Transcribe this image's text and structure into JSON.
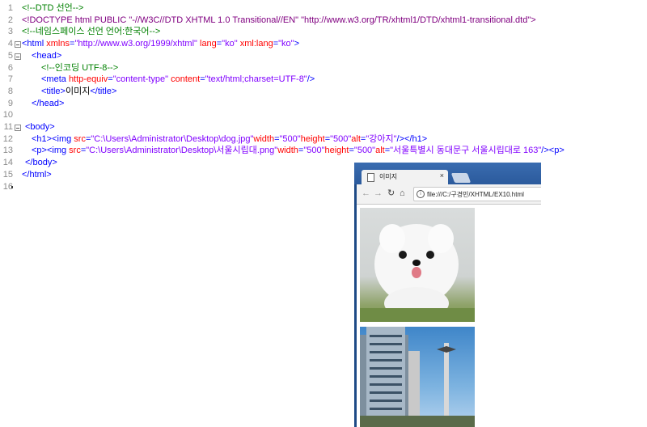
{
  "editor": {
    "lines": [
      {
        "n": "1",
        "fold": false,
        "indent": 27,
        "segs": [
          {
            "t": "<!--DTD 선언-->",
            "c": "com"
          }
        ]
      },
      {
        "n": "2",
        "fold": false,
        "indent": 27,
        "segs": [
          {
            "t": "<!DOCTYPE html PUBLIC \"-//W3C//DTD XHTML 1.0 Transitional//EN\" \"http://www.w3.org/TR/xhtml1/DTD/xhtml1-transitional.dtd\">",
            "c": "doc"
          }
        ]
      },
      {
        "n": "3",
        "fold": false,
        "indent": 27,
        "segs": [
          {
            "t": "<!--네임스페이스 선언 언어:한국어-->",
            "c": "com"
          }
        ]
      },
      {
        "n": "4",
        "fold": true,
        "indent": 27,
        "segs": [
          {
            "t": "<html ",
            "c": "tag"
          },
          {
            "t": "xmlns",
            "c": "attr"
          },
          {
            "t": "=",
            "c": "tag"
          },
          {
            "t": "\"http://www.w3.org/1999/xhtml\"",
            "c": "val"
          },
          {
            "t": " lang",
            "c": "attr"
          },
          {
            "t": "=",
            "c": "tag"
          },
          {
            "t": "\"ko\"",
            "c": "val"
          },
          {
            "t": " xml:lang",
            "c": "attr"
          },
          {
            "t": "=",
            "c": "tag"
          },
          {
            "t": "\"ko\"",
            "c": "val"
          },
          {
            "t": ">",
            "c": "tag"
          }
        ]
      },
      {
        "n": "5",
        "fold": true,
        "indent": 39,
        "segs": [
          {
            "t": "<head>",
            "c": "tag"
          }
        ]
      },
      {
        "n": "6",
        "fold": false,
        "indent": 51,
        "segs": [
          {
            "t": "<!--인코딩 UTF-8-->",
            "c": "com"
          }
        ]
      },
      {
        "n": "7",
        "fold": false,
        "indent": 51,
        "segs": [
          {
            "t": "<meta ",
            "c": "tag"
          },
          {
            "t": "http-equiv",
            "c": "attr"
          },
          {
            "t": "=",
            "c": "tag"
          },
          {
            "t": "\"content-type\"",
            "c": "val"
          },
          {
            "t": " content",
            "c": "attr"
          },
          {
            "t": "=",
            "c": "tag"
          },
          {
            "t": "\"text/html;charset=UTF-8\"",
            "c": "val"
          },
          {
            "t": "/>",
            "c": "tag"
          }
        ]
      },
      {
        "n": "8",
        "fold": false,
        "indent": 51,
        "segs": [
          {
            "t": "<title>",
            "c": "tag"
          },
          {
            "t": "이미지",
            "c": "txt"
          },
          {
            "t": "</title>",
            "c": "tag"
          }
        ]
      },
      {
        "n": "9",
        "fold": false,
        "indent": 39,
        "segs": [
          {
            "t": "</head>",
            "c": "tag"
          }
        ]
      },
      {
        "n": "10",
        "fold": false,
        "indent": 27,
        "segs": []
      },
      {
        "n": "11",
        "fold": true,
        "indent": 31,
        "segs": [
          {
            "t": "<body>",
            "c": "tag"
          }
        ]
      },
      {
        "n": "12",
        "fold": false,
        "indent": 39,
        "segs": [
          {
            "t": "<h1><img ",
            "c": "tag"
          },
          {
            "t": "src",
            "c": "attr"
          },
          {
            "t": "=",
            "c": "tag"
          },
          {
            "t": "\"C:\\Users\\Administrator\\Desktop\\dog.jpg\"",
            "c": "val"
          },
          {
            "t": "width",
            "c": "attr"
          },
          {
            "t": "=",
            "c": "tag"
          },
          {
            "t": "\"500\"",
            "c": "val"
          },
          {
            "t": "height",
            "c": "attr"
          },
          {
            "t": "=",
            "c": "tag"
          },
          {
            "t": "\"500\"",
            "c": "val"
          },
          {
            "t": "alt",
            "c": "attr"
          },
          {
            "t": "=",
            "c": "tag"
          },
          {
            "t": "\"강아지\"",
            "c": "val"
          },
          {
            "t": "/></h1>",
            "c": "tag"
          }
        ]
      },
      {
        "n": "13",
        "fold": false,
        "indent": 39,
        "segs": [
          {
            "t": "<p><img ",
            "c": "tag"
          },
          {
            "t": "src",
            "c": "attr"
          },
          {
            "t": "=",
            "c": "tag"
          },
          {
            "t": "\"C:\\Users\\Administrator\\Desktop\\서울시립대.png\"",
            "c": "val"
          },
          {
            "t": "width",
            "c": "attr"
          },
          {
            "t": "=",
            "c": "tag"
          },
          {
            "t": "\"500\"",
            "c": "val"
          },
          {
            "t": "height",
            "c": "attr"
          },
          {
            "t": "=",
            "c": "tag"
          },
          {
            "t": "\"500\"",
            "c": "val"
          },
          {
            "t": "alt",
            "c": "attr"
          },
          {
            "t": "=",
            "c": "tag"
          },
          {
            "t": "\"서울특별시 동대문구 서울시립대로 163\"",
            "c": "val"
          },
          {
            "t": "/><p>",
            "c": "tag"
          }
        ]
      },
      {
        "n": "14",
        "fold": false,
        "indent": 31,
        "segs": [
          {
            "t": "</body>",
            "c": "tag"
          }
        ]
      },
      {
        "n": "15",
        "fold": false,
        "indent": 27,
        "segs": [
          {
            "t": "</html>",
            "c": "tag"
          }
        ]
      },
      {
        "n": "16",
        "fold": false,
        "indent": 27,
        "segs": []
      }
    ]
  },
  "browser": {
    "tab_title": "이미지",
    "tab_close": "×",
    "url": "file:///C:/구경민/XHTML/EX10.html",
    "nav_icons": [
      "back-arrow-icon",
      "forward-arrow-icon",
      "reload-icon",
      "home-icon"
    ],
    "images": [
      "dog-image",
      "university-building-image"
    ]
  },
  "colors": {
    "comment": "#008000",
    "tag": "#0000ff",
    "attribute": "#ff0000",
    "value": "#8000ff",
    "doctype": "#800080",
    "browser_frame": "#1e4a86"
  }
}
